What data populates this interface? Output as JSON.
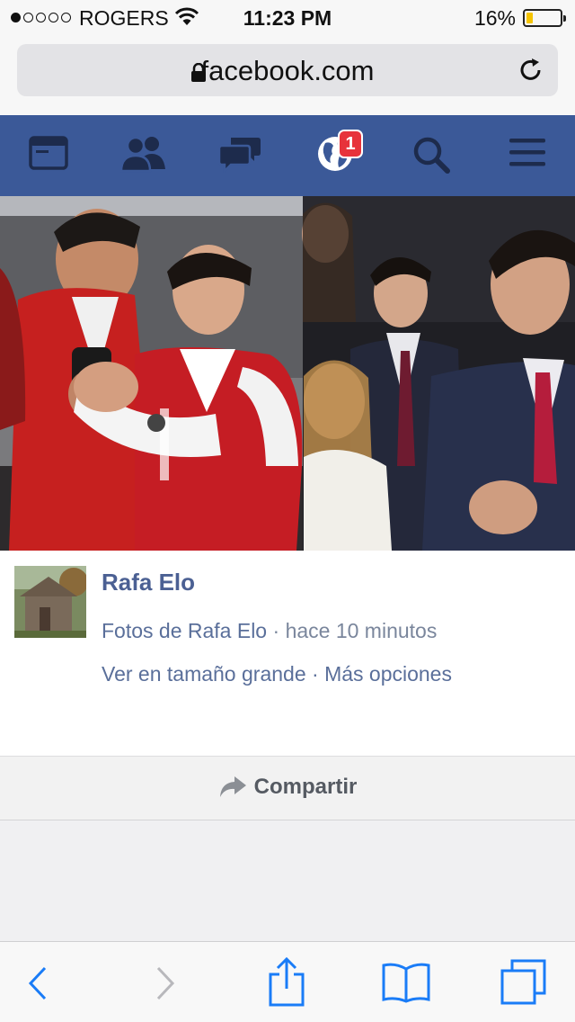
{
  "status_bar": {
    "carrier": "ROGERS",
    "signal_bars_filled": 1,
    "signal_bars_total": 5,
    "time": "11:23 PM",
    "battery_percent": "16%",
    "battery_color": "#f5c400"
  },
  "browser": {
    "url": "facebook.com",
    "lock_icon": "lock-icon",
    "reload_icon": "reload-icon"
  },
  "fb_nav": {
    "items": [
      {
        "icon": "news-feed-icon"
      },
      {
        "icon": "friend-requests-icon"
      },
      {
        "icon": "messages-icon"
      },
      {
        "icon": "notifications-globe-icon",
        "badge": "1"
      },
      {
        "icon": "search-icon"
      },
      {
        "icon": "menu-icon"
      }
    ],
    "bar_color": "#3b5998",
    "badge_color": "#e7333b"
  },
  "post": {
    "author": "Rafa Elo",
    "album": "Fotos de Rafa Elo",
    "separator": " · ",
    "time": "hace 10 minutos",
    "view_large": "Ver en tamaño grande",
    "more_options": "Más opciones"
  },
  "share": {
    "label": "Compartir"
  },
  "toolbar": {
    "back_icon": "back-chevron-icon",
    "forward_icon": "forward-chevron-icon",
    "share_icon": "share-icon",
    "bookmarks_icon": "bookmarks-icon",
    "tabs_icon": "tabs-icon",
    "accent_color": "#1a7cf7"
  }
}
